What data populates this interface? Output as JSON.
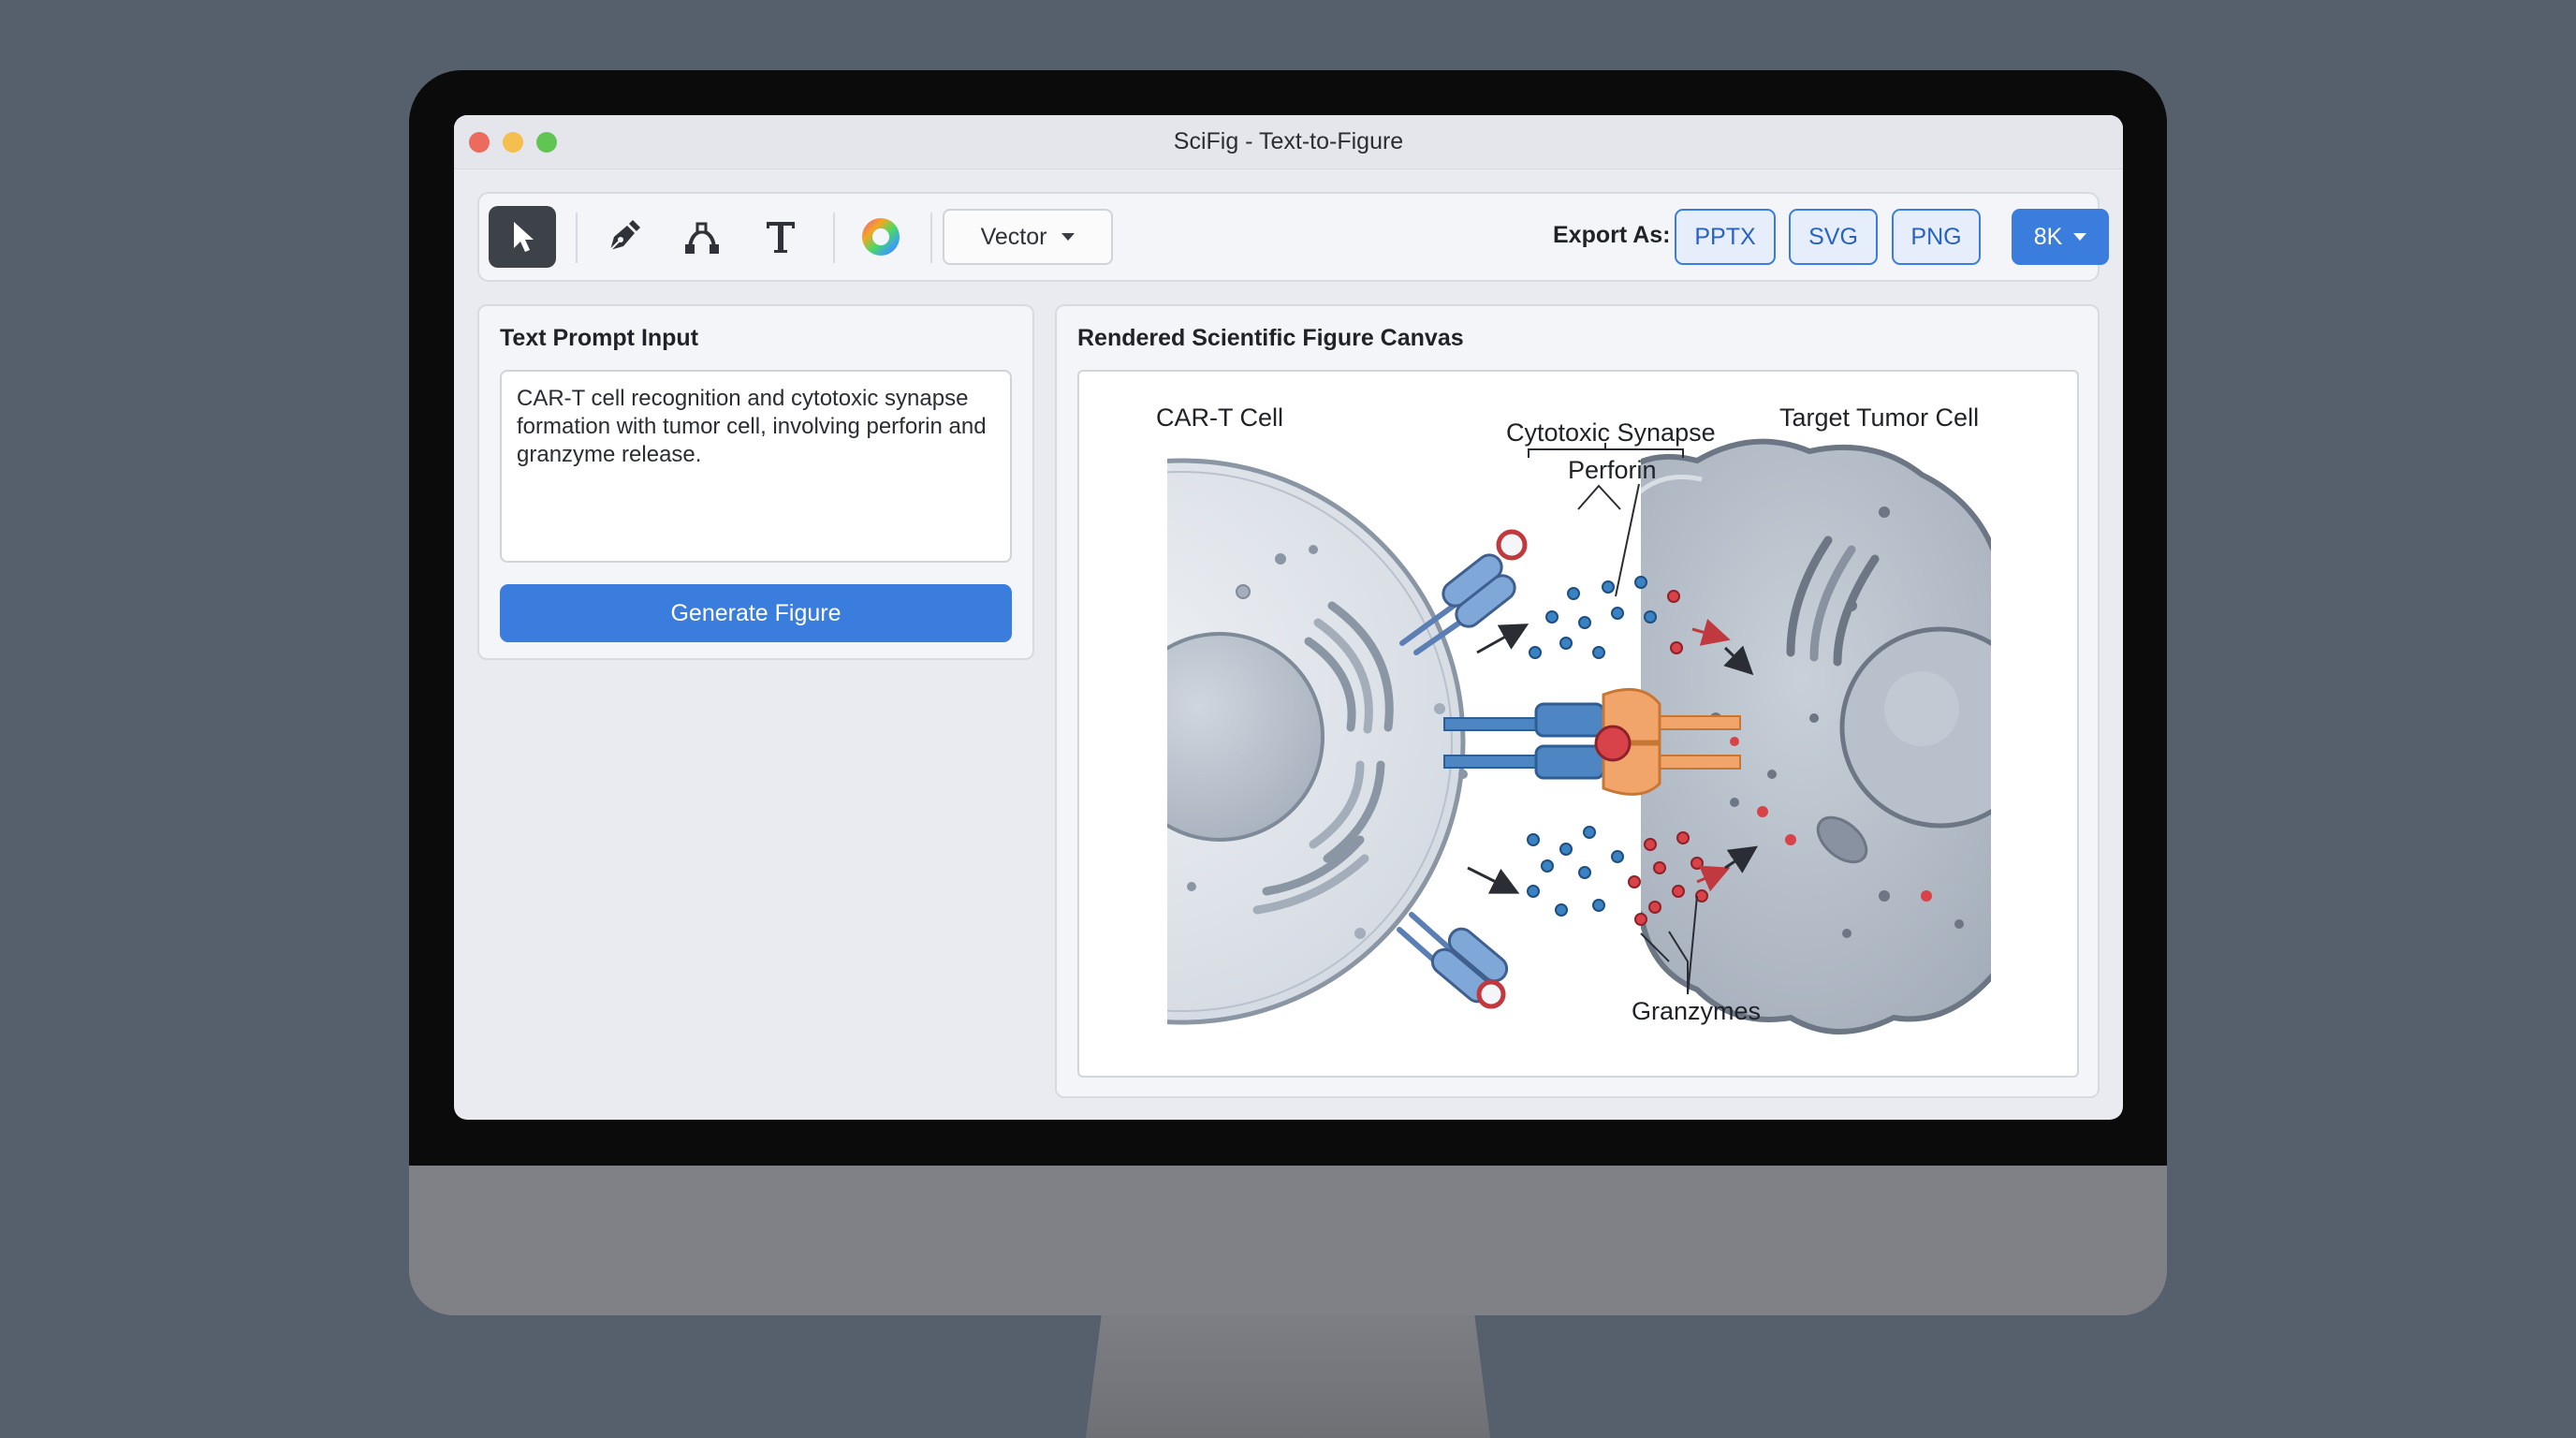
{
  "window": {
    "title": "SciFig - Text-to-Figure"
  },
  "toolbar": {
    "tools": [
      "select-tool",
      "pen-tool",
      "curve-tool",
      "text-tool",
      "color-tool"
    ],
    "mode_select": {
      "value": "Vector"
    },
    "export_label": "Export As:",
    "export_buttons": [
      "PPTX",
      "SVG",
      "PNG"
    ],
    "resolution": "8K"
  },
  "prompt_panel": {
    "title": "Text Prompt Input",
    "prompt_text": "CAR-T cell recognition and cytotoxic synapse formation with tumor cell, involving perforin and granzyme release.",
    "generate_label": "Generate Figure"
  },
  "canvas_panel": {
    "title": "Rendered Scientific Figure Canvas",
    "figure": {
      "left_cell_label": "CAR-T Cell",
      "synapse_label": "Cytotoxic Synapse",
      "perforin_label": "Perforin",
      "right_cell_label": "Target Tumor Cell",
      "granzymes_label": "Granzymes"
    }
  },
  "colors": {
    "accent": "#3b7ddd",
    "perforin": "#3a82c4",
    "granzyme": "#d8434a",
    "receptor": "#f2a56a"
  }
}
